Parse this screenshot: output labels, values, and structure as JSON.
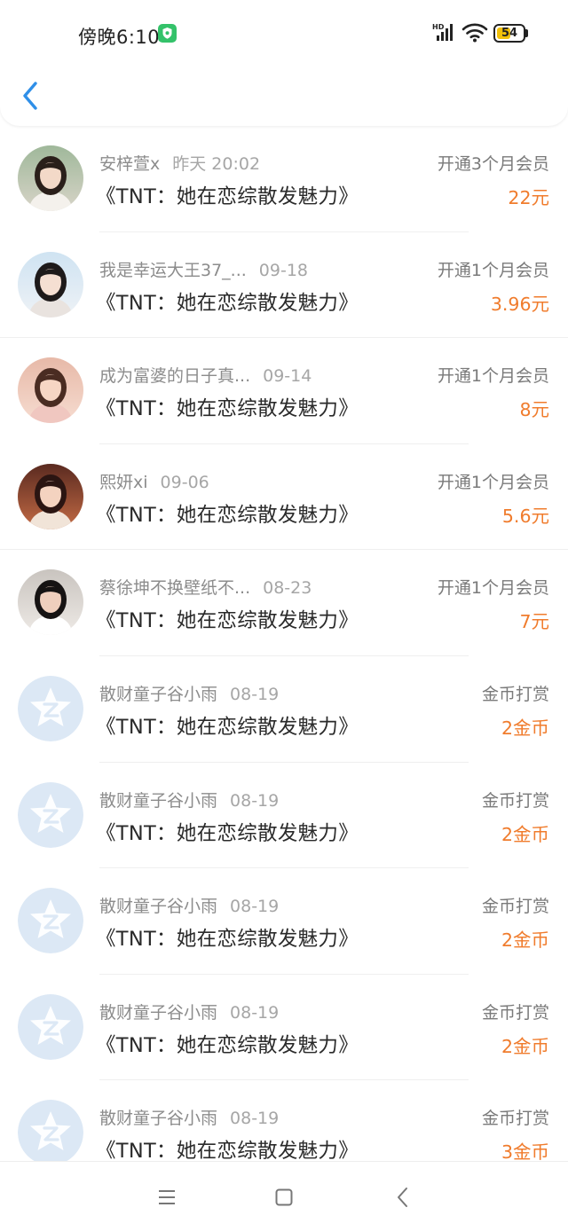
{
  "status_bar": {
    "time": "傍晚6:10",
    "battery": "54",
    "battery_level": 0.54,
    "network": "HD"
  },
  "header": {
    "back_icon": "chevron-left-icon"
  },
  "records": [
    {
      "name": "安梓萱x",
      "date": "昨天 20:02",
      "title": "《TNT：她在恋综散发魅力》",
      "type": "开通3个月会员",
      "amount": "22元",
      "avatar": "photo"
    },
    {
      "name": "我是幸运大王37_...",
      "date": "09-18",
      "title": "《TNT：她在恋综散发魅力》",
      "type": "开通1个月会员",
      "amount": "3.96元",
      "avatar": "photo"
    },
    {
      "name": "成为富婆的日子真...",
      "date": "09-14",
      "title": "《TNT：她在恋综散发魅力》",
      "type": "开通1个月会员",
      "amount": "8元",
      "avatar": "photo"
    },
    {
      "name": "熙妍xi",
      "date": "09-06",
      "title": "《TNT：她在恋综散发魅力》",
      "type": "开通1个月会员",
      "amount": "5.6元",
      "avatar": "photo"
    },
    {
      "name": "蔡徐坤不换壁纸不...",
      "date": "08-23",
      "title": "《TNT：她在恋综散发魅力》",
      "type": "开通1个月会员",
      "amount": "7元",
      "avatar": "photo"
    },
    {
      "name": "散财童子谷小雨",
      "date": "08-19",
      "title": "《TNT：她在恋综散发魅力》",
      "type": "金币打赏",
      "amount": "2金币",
      "avatar": "default"
    },
    {
      "name": "散财童子谷小雨",
      "date": "08-19",
      "title": "《TNT：她在恋综散发魅力》",
      "type": "金币打赏",
      "amount": "2金币",
      "avatar": "default"
    },
    {
      "name": "散财童子谷小雨",
      "date": "08-19",
      "title": "《TNT：她在恋综散发魅力》",
      "type": "金币打赏",
      "amount": "2金币",
      "avatar": "default"
    },
    {
      "name": "散财童子谷小雨",
      "date": "08-19",
      "title": "《TNT：她在恋综散发魅力》",
      "type": "金币打赏",
      "amount": "2金币",
      "avatar": "default"
    },
    {
      "name": "散财童子谷小雨",
      "date": "08-19",
      "title": "《TNT：她在恋综散发魅力》",
      "type": "金币打赏",
      "amount": "3金币",
      "avatar": "default"
    }
  ],
  "colors": {
    "accent_blue": "#2f8fe8",
    "amount_orange": "#f07c2d",
    "default_avatar": "#dce8f5"
  },
  "navbar": {
    "menu_icon": "menu-icon",
    "home_icon": "home-square-icon",
    "back_icon": "back-triangle-icon"
  }
}
